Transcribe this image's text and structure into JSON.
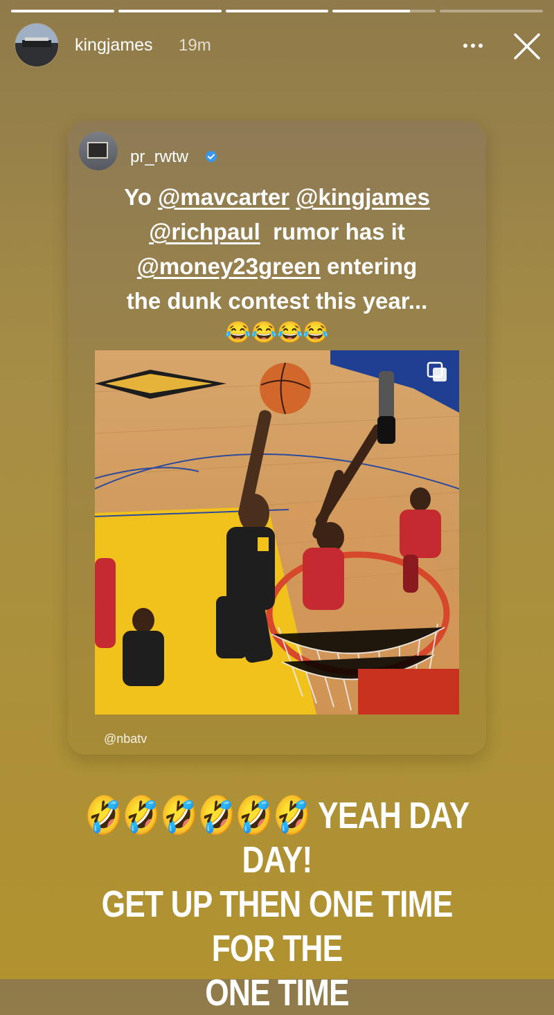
{
  "story": {
    "segments": [
      {
        "progress": 1
      },
      {
        "progress": 1
      },
      {
        "progress": 1
      },
      {
        "progress": 0.75
      },
      {
        "progress": 0
      }
    ]
  },
  "header": {
    "username": "kingjames",
    "time": "19m",
    "icons": {
      "more": "more-icon",
      "close": "close-icon"
    }
  },
  "post": {
    "username": "pr_rwtw",
    "verified": true,
    "caption": {
      "line1_prefix": "Yo ",
      "m1": "@mavcarter",
      "space1": " ",
      "m2": "@kingjames",
      "m3": "@richpaul",
      "line2_suffix": "  rumor has it",
      "m4": "@money23green",
      "line3_suffix": " entering",
      "line4": "the dunk contest this year...",
      "emojis": "😂😂😂😂"
    },
    "attribution": "@nbatv"
  },
  "story_text": {
    "line1": "🤣🤣🤣🤣🤣🤣 YEAH DAY DAY!",
    "line2": "GET UP THEN ONE TIME FOR THE",
    "line3": "ONE TIME"
  },
  "colors": {
    "background_top": "#8f7a4b",
    "background_bottom": "#b1922f",
    "verified_blue": "#3897f0"
  }
}
